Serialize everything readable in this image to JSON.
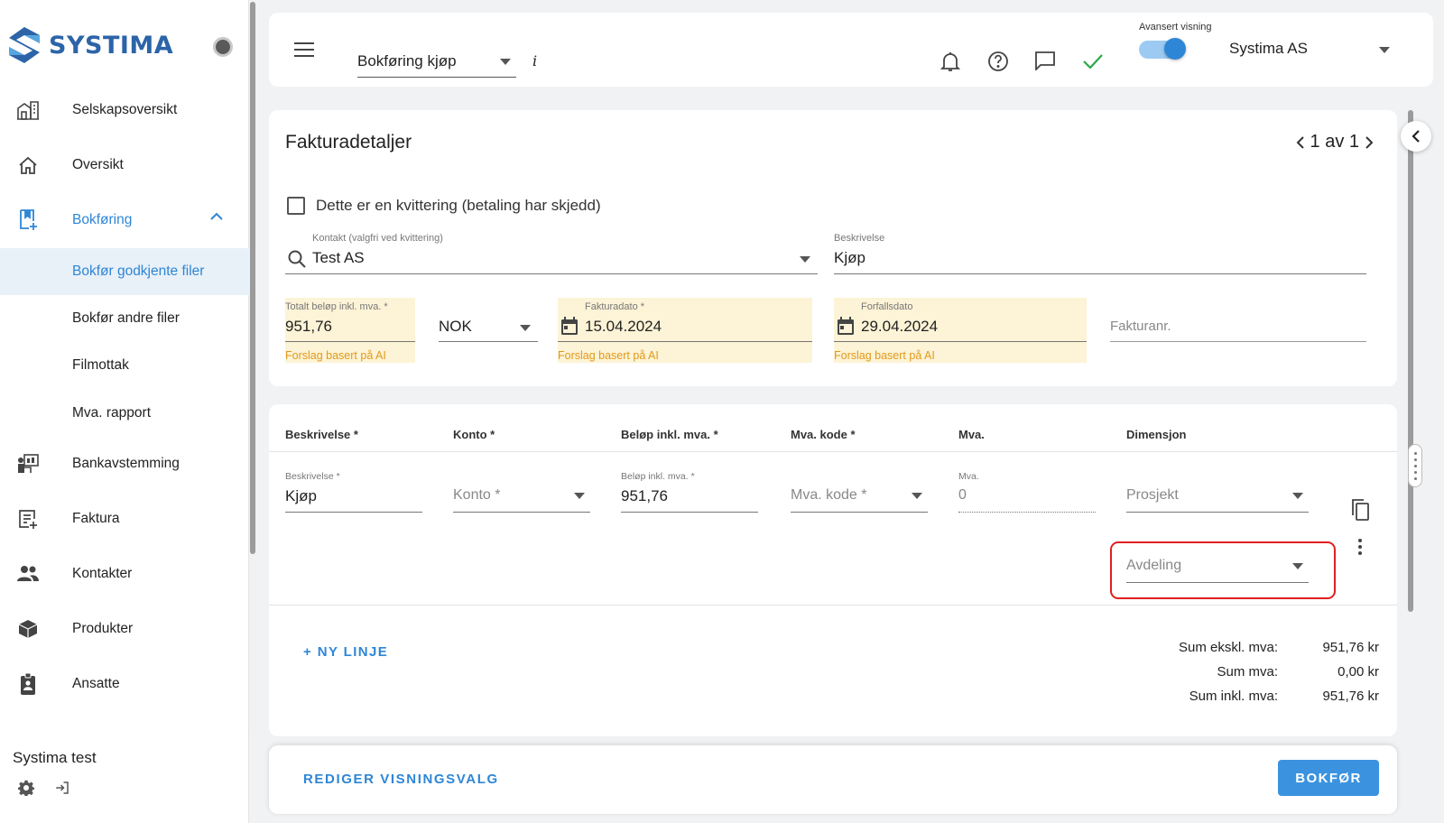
{
  "brand": {
    "name": "SYSTIMA",
    "color": "#2c64a8",
    "accent": "#2e86d6"
  },
  "sidebar": {
    "items": [
      {
        "label": "Selskapsoversikt",
        "icon": "building-icon"
      },
      {
        "label": "Oversikt",
        "icon": "home-icon"
      },
      {
        "label": "Bokføring",
        "icon": "book-add-icon"
      },
      {
        "label": "Bokfør godkjente filer"
      },
      {
        "label": "Bokfør andre filer"
      },
      {
        "label": "Filmottak"
      },
      {
        "label": "Mva. rapport"
      },
      {
        "label": "Bankavstemming",
        "icon": "bank-reconcile-icon"
      },
      {
        "label": "Faktura",
        "icon": "invoice-icon"
      },
      {
        "label": "Kontakter",
        "icon": "people-icon"
      },
      {
        "label": "Produkter",
        "icon": "box-icon"
      },
      {
        "label": "Ansatte",
        "icon": "badge-icon"
      }
    ],
    "company": "Systima test"
  },
  "topbar": {
    "module": "Bokføring kjøp",
    "info": "i",
    "advanced_label": "Avansert visning",
    "advanced_on": true,
    "company": "Systima AS"
  },
  "details": {
    "title": "Fakturadetaljer",
    "pager": "1 av 1",
    "receipt_checkbox": "Dette er en kvittering (betaling har skjedd)",
    "contact_label": "Kontakt (valgfri ved kvittering)",
    "contact_value": "Test AS",
    "description_label": "Beskrivelse",
    "description_value": "Kjøp",
    "total_label": "Totalt beløp inkl. mva. *",
    "total_value": "951,76",
    "currency": "NOK",
    "invoice_date_label": "Fakturadato *",
    "invoice_date": "15.04.2024",
    "due_date_label": "Forfallsdato",
    "due_date": "29.04.2024",
    "invoice_no_placeholder": "Fakturanr.",
    "ai_hint": "Forslag basert på AI"
  },
  "lines": {
    "headers": [
      "Beskrivelse *",
      "Konto *",
      "Beløp inkl. mva. *",
      "Mva. kode *",
      "Mva.",
      "Dimensjon"
    ],
    "row": {
      "desc_label": "Beskrivelse *",
      "desc_value": "Kjøp",
      "account_placeholder": "Konto *",
      "amount_label": "Beløp inkl. mva. *",
      "amount_value": "951,76",
      "vat_code_placeholder": "Mva. kode *",
      "vat_label": "Mva.",
      "vat_value": "0",
      "project_placeholder": "Prosjekt",
      "department_placeholder": "Avdeling"
    },
    "new_line": "+ NY LINJE",
    "sums": [
      {
        "label": "Sum ekskl. mva:",
        "value": "951,76 kr"
      },
      {
        "label": "Sum mva:",
        "value": "0,00 kr"
      },
      {
        "label": "Sum inkl. mva:",
        "value": "951,76 kr"
      }
    ]
  },
  "actions": {
    "edit_view": "REDIGER VISNINGSVALG",
    "submit": "BOKFØR"
  }
}
